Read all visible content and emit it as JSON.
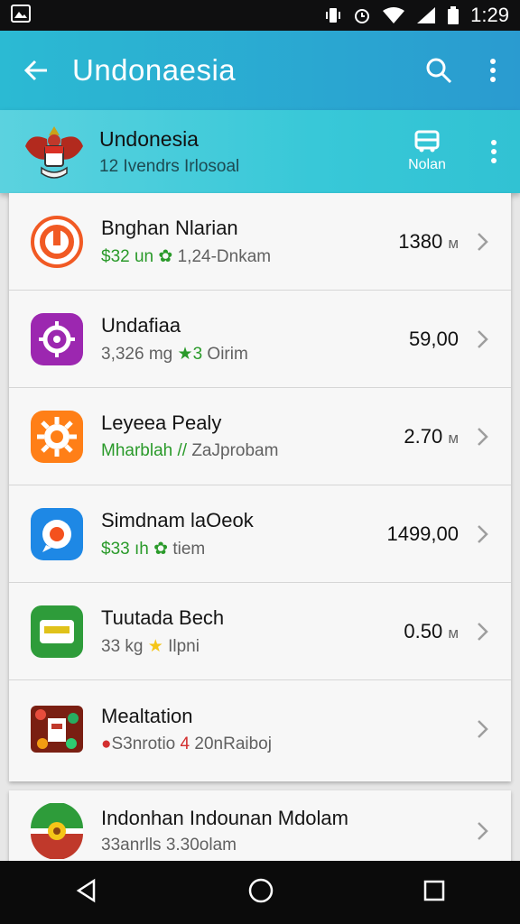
{
  "status_bar": {
    "time": "1:29"
  },
  "app_bar": {
    "title": "Undonaesia"
  },
  "header": {
    "title": "Undonesia",
    "subtitle": "12 Ivendrs Irlosoal",
    "button_label": "Nolan"
  },
  "items": [
    {
      "name": "Bnghan Nlarian",
      "meta_prefix": "$32 un",
      "meta_icon": "leaf-icon",
      "meta_suffix": "1,24-Dnkam",
      "price": "1380",
      "unit": "м",
      "icon": "recycle-app-icon",
      "color": "#f15a24"
    },
    {
      "name": "Undafiaa",
      "meta_prefix": "3,326 mg",
      "meta_icon": "star-icon",
      "meta_count": "3",
      "meta_suffix": "Oirim",
      "price": "59,00",
      "unit": "",
      "icon": "settings-app-icon",
      "color": "#9c27b0"
    },
    {
      "name": "Leyeea Pealy",
      "meta_prefix": "Mharblah //",
      "meta_icon": "",
      "meta_suffix": "ZaJprobam",
      "price": "2.70",
      "unit": "м",
      "icon": "gear-app-icon",
      "color": "#ff7f17"
    },
    {
      "name": "Simdnam laOeok",
      "meta_prefix": "$33 ıh",
      "meta_icon": "leaf-icon",
      "meta_suffix": "tiem",
      "price": "1499,00",
      "unit": "",
      "icon": "chat-app-icon",
      "color": "#1e88e5"
    },
    {
      "name": "Tuutada Bech",
      "meta_prefix": "33 kg",
      "meta_icon": "star-icon",
      "meta_suffix": "Ilpni",
      "price": "0.50",
      "unit": "м",
      "icon": "wallet-app-icon",
      "color": "#2e9c3a"
    },
    {
      "name": "Mealtation",
      "meta_prefix": "S3nrotio",
      "meta_icon": "pin-icon",
      "meta_count": "4",
      "meta_suffix": "20nRaiboj",
      "price": "",
      "unit": "",
      "icon": "food-app-icon",
      "color": "#c0392b"
    }
  ],
  "bottom_item": {
    "name": "Indonhan Indounan Mdolam",
    "meta": "33anrlls 3.30olam",
    "icon": "emblem-icon"
  },
  "colors": {
    "app_bar": "#2bbad3",
    "header": "#3fcbd9",
    "green": "#2a9a2a",
    "background": "#e7e7e7"
  }
}
